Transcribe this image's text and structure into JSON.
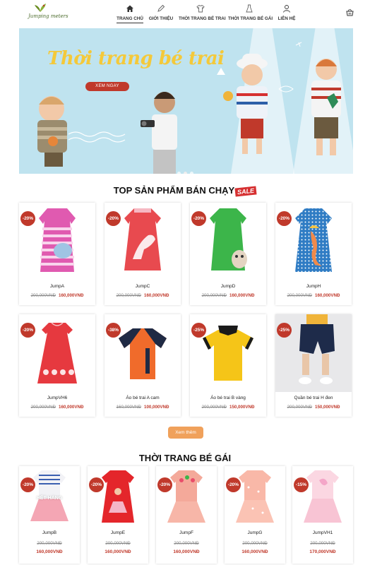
{
  "brand": {
    "logo_text": "Jumping meters",
    "colors": {
      "accent": "#c0392b",
      "more": "#f0a15b",
      "banner_bg": "#bfe3ef"
    }
  },
  "nav": {
    "items": [
      {
        "label": "TRANG CHỦ",
        "icon": "home-icon"
      },
      {
        "label": "GIỚI THIỆU",
        "icon": "pencil-icon"
      },
      {
        "label": "THỜI TRANG BÉ TRAI",
        "icon": "shirt-icon"
      },
      {
        "label": "THỜI TRANG BÉ GÁI",
        "icon": "dress-icon"
      },
      {
        "label": "LIÊN HỆ",
        "icon": "user-icon"
      }
    ],
    "cart_icon": "basket-icon"
  },
  "banner": {
    "title": "Thời trang bé trai",
    "button": "XEM NGAY",
    "slide_index": 2,
    "slide_count": 3
  },
  "top_section": {
    "title": "TOP SẢN PHẨM BÁN CHẠY",
    "badge": "SALE",
    "products": [
      {
        "name": "JumpA",
        "discount": "-20%",
        "old_price": "200,000VNĐ",
        "new_price": "160,000VNĐ"
      },
      {
        "name": "JumpC",
        "discount": "-20%",
        "old_price": "200,000VNĐ",
        "new_price": "160,000VNĐ"
      },
      {
        "name": "JumpD",
        "discount": "-20%",
        "old_price": "200,000VNĐ",
        "new_price": "160,000VNĐ"
      },
      {
        "name": "JumpH",
        "discount": "-20%",
        "old_price": "200,000VNĐ",
        "new_price": "160,000VNĐ"
      },
      {
        "name": "JumpVH6",
        "discount": "-20%",
        "old_price": "200,000VNĐ",
        "new_price": "160,000VNĐ"
      },
      {
        "name": "Áo bé trai A cam",
        "discount": "-38%",
        "old_price": "160,000VNĐ",
        "new_price": "100,000VNĐ"
      },
      {
        "name": "Áo bé trai B vàng",
        "discount": "-25%",
        "old_price": "200,000VNĐ",
        "new_price": "150,000VNĐ"
      },
      {
        "name": "Quần bé trai H đen",
        "discount": "-25%",
        "old_price": "200,000VNĐ",
        "new_price": "150,000VNĐ"
      }
    ],
    "more_button": "Xem thêm"
  },
  "girls_section": {
    "title": "THỜI TRANG BÉ GÁI",
    "products": [
      {
        "name": "JumpB",
        "discount": "-20%",
        "old_price": "200,000VNĐ",
        "new_price": "160,000VNĐ",
        "status": "HẾT HÀNG"
      },
      {
        "name": "JumpE",
        "discount": "-20%",
        "old_price": "200,000VNĐ",
        "new_price": "160,000VNĐ"
      },
      {
        "name": "JumpF",
        "discount": "-20%",
        "old_price": "200,000VNĐ",
        "new_price": "160,000VNĐ"
      },
      {
        "name": "JumpG",
        "discount": "-20%",
        "old_price": "200,000VNĐ",
        "new_price": "160,000VNĐ"
      },
      {
        "name": "JumpVH1",
        "discount": "-15%",
        "old_price": "200,000VNĐ",
        "new_price": "170,000VNĐ"
      }
    ]
  }
}
